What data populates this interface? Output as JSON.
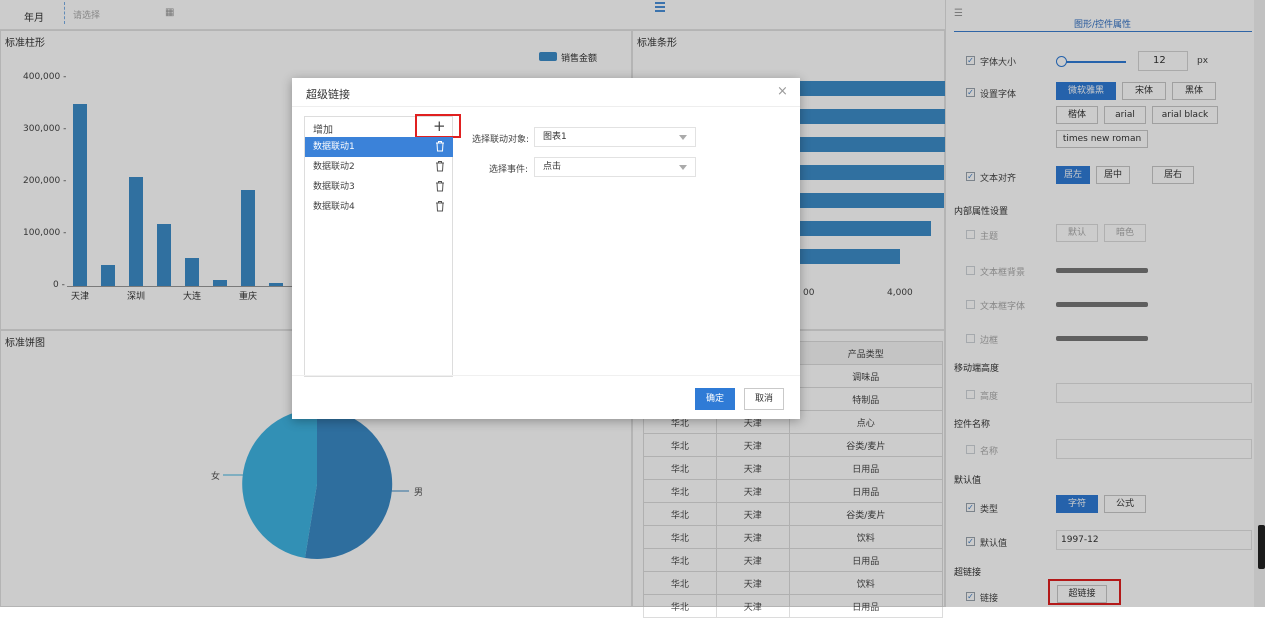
{
  "filter": {
    "label": "年月",
    "placeholder": "请选择"
  },
  "colors": {
    "bar": "#3d8cc9",
    "pie_dark": "#3a8ac6",
    "pie_light": "#3fb5e3",
    "primary": "#2f7bd6",
    "highlight": "#e02020"
  },
  "bar_panel": {
    "title": "标准柱形",
    "legend": "销售金额",
    "yticks": [
      "400,000 -",
      "300,000 -",
      "200,000 -",
      "100,000 -",
      "0 -"
    ],
    "xcats": [
      "天津",
      "深圳",
      "大连",
      "重庆"
    ]
  },
  "hbar_panel": {
    "title": "标准条形",
    "xticks": [
      "00",
      "4,000"
    ]
  },
  "pie_panel": {
    "title": "标准饼图",
    "labels": [
      "女",
      "男"
    ]
  },
  "chart_data": [
    {
      "type": "bar",
      "title": "标准柱形",
      "series": [
        {
          "name": "销售金额",
          "values": [
            358000,
            42000,
            213000,
            121000,
            55000,
            11000,
            188000,
            6000
          ]
        }
      ],
      "categories": [
        "天津",
        "",
        "深圳",
        "",
        "大连",
        "",
        "重庆",
        ""
      ],
      "ylim": [
        0,
        420000
      ],
      "legend": "top-right"
    },
    {
      "type": "bar",
      "title": "标准条形",
      "orientation": "horizontal",
      "values": [
        5200,
        5000,
        5000,
        4900,
        4900,
        4700,
        4200,
        1400
      ]
    },
    {
      "type": "pie",
      "title": "标准饼图",
      "slices": [
        {
          "label": "男",
          "value": 53
        },
        {
          "label": "女",
          "value": 47
        }
      ]
    }
  ],
  "table": {
    "headers": [
      "",
      "城市",
      "产品类型"
    ],
    "rows": [
      [
        "",
        "",
        "调味品"
      ],
      [
        "",
        "",
        "特制品"
      ],
      [
        "华北",
        "天津",
        "点心"
      ],
      [
        "华北",
        "天津",
        "谷类/麦片"
      ],
      [
        "华北",
        "天津",
        "日用品"
      ],
      [
        "华北",
        "天津",
        "日用品"
      ],
      [
        "华北",
        "天津",
        "谷类/麦片"
      ],
      [
        "华北",
        "天津",
        "饮料"
      ],
      [
        "华北",
        "天津",
        "日用品"
      ],
      [
        "华北",
        "天津",
        "饮料"
      ],
      [
        "华北",
        "天津",
        "日用品"
      ]
    ]
  },
  "props": {
    "title": "图形/控件属性",
    "font_size": {
      "label": "字体大小",
      "value": "12",
      "unit": "px"
    },
    "font_family": {
      "label": "设置字体",
      "options": [
        "微软雅黑",
        "宋体",
        "黑体",
        "楷体",
        "arial",
        "arial black",
        "times new roman"
      ]
    },
    "align": {
      "label": "文本对齐",
      "options": [
        "居左",
        "居中",
        "居右"
      ]
    },
    "inner_section": "内部属性设置",
    "theme": {
      "label": "主题",
      "options": [
        "默认",
        "暗色"
      ]
    },
    "text_bg": "文本框背景",
    "text_font": "文本框字体",
    "border": "边框",
    "mobile_section": "移动端高度",
    "height": "高度",
    "name_section": "控件名称",
    "name": "名称",
    "default_section": "默认值",
    "type": {
      "label": "类型",
      "options": [
        "字符",
        "公式"
      ]
    },
    "default_value": {
      "label": "默认值",
      "value": "1997-12"
    },
    "link_section": "超链接",
    "link": {
      "label": "链接",
      "button": "超链接"
    }
  },
  "dialog": {
    "title": "超级链接",
    "close": "×",
    "add_label": "增加",
    "add_icon": "+",
    "items": [
      "数据联动1",
      "数据联动2",
      "数据联动3",
      "数据联动4"
    ],
    "target_label": "选择联动对象:",
    "target_value": "图表1",
    "event_label": "选择事件:",
    "event_value": "点击",
    "ok": "确定",
    "cancel": "取消"
  }
}
